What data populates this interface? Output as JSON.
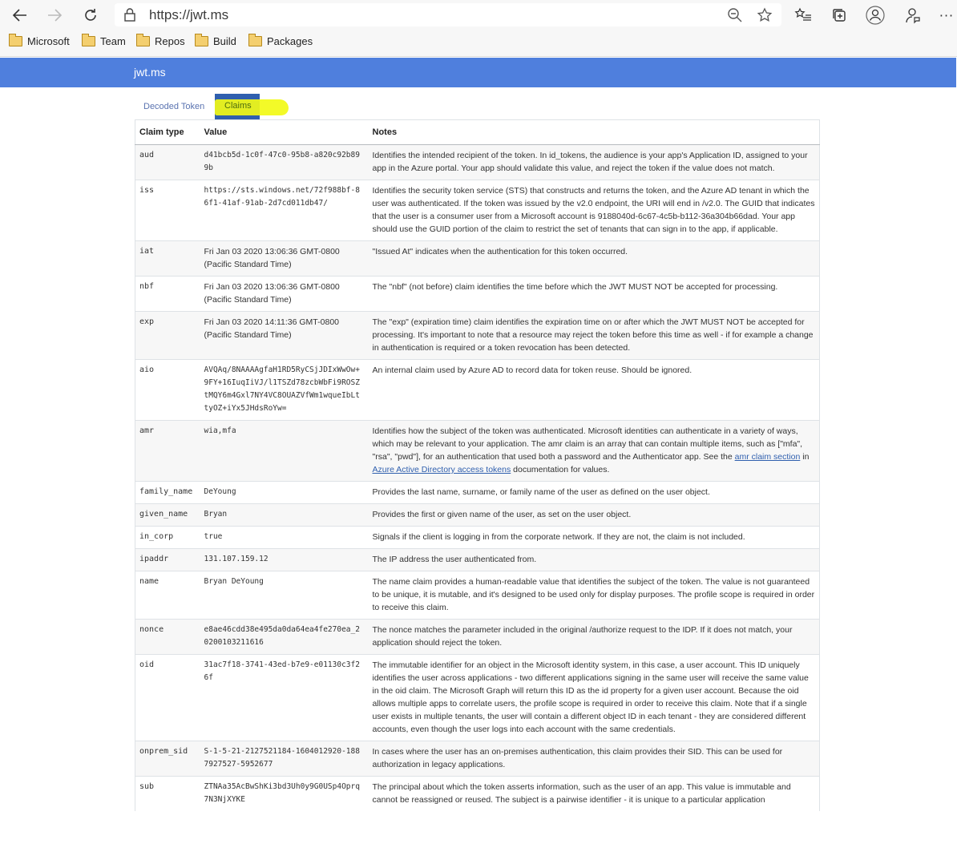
{
  "browser": {
    "url": "https://jwt.ms",
    "favorites": [
      {
        "label": "Microsoft"
      },
      {
        "label": "Team"
      },
      {
        "label": "Repos"
      },
      {
        "label": "Build"
      },
      {
        "label": "Packages"
      }
    ]
  },
  "site": {
    "brand": "jwt.ms",
    "tabs": [
      {
        "label": "Decoded Token",
        "active": false
      },
      {
        "label": "Claims",
        "active": true
      }
    ]
  },
  "table": {
    "headers": [
      "Claim type",
      "Value",
      "Notes"
    ],
    "rows": [
      {
        "type": "aud",
        "value": "d41bcb5d-1c0f-47c0-95b8-a820c92b899b",
        "notes": "Identifies the intended recipient of the token. In id_tokens, the audience is your app's Application ID, assigned to your app in the Azure portal. Your app should validate this value, and reject the token if the value does not match."
      },
      {
        "type": "iss",
        "value": "https://sts.windows.net/72f988bf-86f1-41af-91ab-2d7cd011db47/",
        "notes": "Identifies the security token service (STS) that constructs and returns the token, and the Azure AD tenant in which the user was authenticated. If the token was issued by the v2.0 endpoint, the URI will end in /v2.0. The GUID that indicates that the user is a consumer user from a Microsoft account is 9188040d-6c67-4c5b-b112-36a304b66dad. Your app should use the GUID portion of the claim to restrict the set of tenants that can sign in to the app, if applicable."
      },
      {
        "type": "iat",
        "value": "Fri Jan 03 2020 13:06:36 GMT-0800 (Pacific Standard Time)",
        "notes": "\"Issued At\" indicates when the authentication for this token occurred."
      },
      {
        "type": "nbf",
        "value": "Fri Jan 03 2020 13:06:36 GMT-0800 (Pacific Standard Time)",
        "notes": "The \"nbf\" (not before) claim identifies the time before which the JWT MUST NOT be accepted for processing."
      },
      {
        "type": "exp",
        "value": "Fri Jan 03 2020 14:11:36 GMT-0800 (Pacific Standard Time)",
        "notes": "The \"exp\" (expiration time) claim identifies the expiration time on or after which the JWT MUST NOT be accepted for processing. It's important to note that a resource may reject the token before this time as well - if for example a change in authentication is required or a token revocation has been detected."
      },
      {
        "type": "aio",
        "value": "AVQAq/8NAAAAgfaH1RD5RyCSjJDIxWwOw+9FY+16IuqIiVJ/l1TSZd78zcbWbFi9ROSZtMQY6m4Gxl7NY4VC8OUAZVfWm1wqueIbLttyOZ+iYx5JHdsRoYw=",
        "notes": "An internal claim used by Azure AD to record data for token reuse. Should be ignored."
      },
      {
        "type": "amr",
        "value": "wia,mfa",
        "notes_before": "Identifies how the subject of the token was authenticated. Microsoft identities can authenticate in a variety of ways, which may be relevant to your application. The amr claim is an array that can contain multiple items, such as [\"mfa\", \"rsa\", \"pwd\"], for an authentication that used both a password and the Authenticator app. See the ",
        "link1": "amr claim section",
        "notes_middle": " in ",
        "link2": "Azure Active Directory access tokens",
        "notes_after": " documentation for values."
      },
      {
        "type": "family_name",
        "value": "DeYoung",
        "notes": "Provides the last name, surname, or family name of the user as defined on the user object."
      },
      {
        "type": "given_name",
        "value": "Bryan",
        "notes": "Provides the first or given name of the user, as set on the user object."
      },
      {
        "type": "in_corp",
        "value": "true",
        "notes": "Signals if the client is logging in from the corporate network. If they are not, the claim is not included."
      },
      {
        "type": "ipaddr",
        "value": "131.107.159.12",
        "notes": "The IP address the user authenticated from."
      },
      {
        "type": "name",
        "value": "Bryan DeYoung",
        "notes": "The name claim provides a human-readable value that identifies the subject of the token. The value is not guaranteed to be unique, it is mutable, and it's designed to be used only for display purposes. The profile scope is required in order to receive this claim."
      },
      {
        "type": "nonce",
        "value": "e8ae46cdd38e495da0da64ea4fe270ea_20200103211616",
        "notes": "The nonce matches the parameter included in the original /authorize request to the IDP. If it does not match, your application should reject the token."
      },
      {
        "type": "oid",
        "value": "31ac7f18-3741-43ed-b7e9-e01130c3f26f",
        "notes": "The immutable identifier for an object in the Microsoft identity system, in this case, a user account. This ID uniquely identifies the user across applications - two different applications signing in the same user will receive the same value in the oid claim. The Microsoft Graph will return this ID as the id property for a given user account. Because the oid allows multiple apps to correlate users, the profile scope is required in order to receive this claim. Note that if a single user exists in multiple tenants, the user will contain a different object ID in each tenant - they are considered different accounts, even though the user logs into each account with the same credentials."
      },
      {
        "type": "onprem_sid",
        "value": "S-1-5-21-2127521184-1604012920-1887927527-5952677",
        "notes": "In cases where the user has an on-premises authentication, this claim provides their SID. This can be used for authorization in legacy applications."
      },
      {
        "type": "sub",
        "value": "ZTNAa35AcBwShKi3bd3Uh0y9G0USp4Oprq7N3NjXYKE",
        "notes": "The principal about which the token asserts information, such as the user of an app. This value is immutable and cannot be reassigned or reused. The subject is a pairwise identifier - it is unique to a particular application"
      }
    ]
  }
}
